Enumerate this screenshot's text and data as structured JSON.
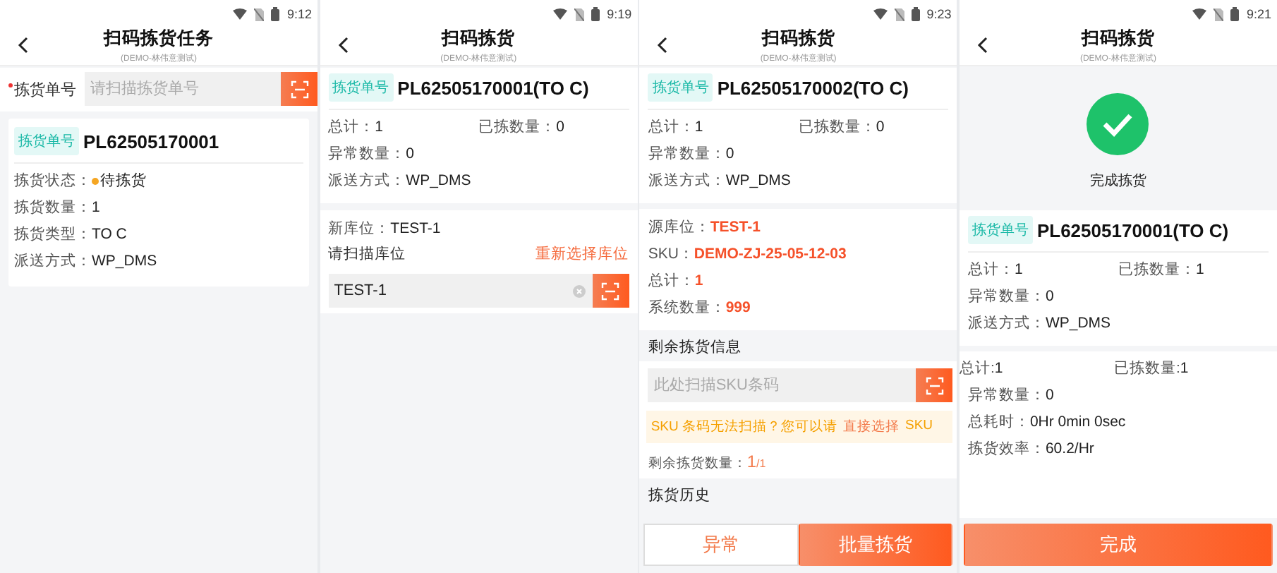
{
  "screens": [
    {
      "time": "9:12",
      "title": "扫码拣货任务",
      "subtitle": "(DEMO-林伟意测试)",
      "blocks": [
        {
          "kind": "scan_row",
          "label": "拣货单号",
          "required": true,
          "placeholder": "请扫描拣货单号"
        },
        {
          "kind": "order_card",
          "tag": "拣货单号",
          "number": "PL62505170001",
          "rows": [
            [
              {
                "label": "拣货状态：",
                "value": "待拣货",
                "color": "#f5a623"
              }
            ],
            [
              {
                "label": "拣货数量：",
                "value": "1"
              }
            ],
            [
              {
                "label": "拣货类型：",
                "value": "TO C"
              }
            ],
            [
              {
                "label": "派送方式：",
                "value": "WP_DMS"
              }
            ]
          ]
        }
      ]
    },
    {
      "time": "9:19",
      "title": "扫码拣货",
      "subtitle": "(DEMO-林伟意测试)",
      "blocks": [
        {
          "kind": "order_summary",
          "tag": "拣货单号",
          "number": "PL62505170001(TO C)",
          "rows": [
            [
              {
                "label": "总计：",
                "value": "1"
              },
              {
                "label": "已拣数量：",
                "value": "0"
              }
            ],
            [
              {
                "label": "异常数量：",
                "value": "0"
              }
            ],
            [
              {
                "label": "派送方式：",
                "value": "WP_DMS"
              }
            ]
          ]
        },
        {
          "kind": "location",
          "rows": [
            [
              {
                "label": "新库位：",
                "value": "TEST-1"
              }
            ]
          ],
          "prompt": "请扫描库位",
          "link": "重新选择库位",
          "value": "TEST-1"
        }
      ]
    },
    {
      "time": "9:23",
      "title": "扫码拣货",
      "subtitle": "(DEMO-林伟意测试)",
      "blocks": [
        {
          "kind": "order_summary",
          "tag": "拣货单号",
          "number": "PL62505170002(TO C)",
          "rows": [
            [
              {
                "label": "总计：",
                "value": "1"
              },
              {
                "label": "已拣数量：",
                "value": "0"
              }
            ],
            [
              {
                "label": "异常数量：",
                "value": "0"
              }
            ],
            [
              {
                "label": "派送方式：",
                "value": "WP_DMS"
              }
            ]
          ]
        },
        {
          "kind": "detail",
          "rows": [
            [
              {
                "label": "源库位：",
                "value": "TEST-1",
                "emphasis": true
              }
            ],
            [
              {
                "label": "SKU：",
                "value": "DEMO-ZJ-25-05-12-03",
                "emphasis": true
              }
            ],
            [
              {
                "label": "总计：",
                "value": "1",
                "emphasis": true
              }
            ],
            [
              {
                "label": "系统数量：",
                "value": "999",
                "emphasis": true
              }
            ]
          ]
        },
        {
          "kind": "section_title",
          "text": "剩余拣货信息"
        },
        {
          "kind": "sku_scan",
          "placeholder": "此处扫描SKU条码"
        },
        {
          "kind": "hint",
          "text": "SKU 条码无法扫描？您可以请",
          "link": "直接选择",
          "tail": "SKU"
        },
        {
          "kind": "remaining",
          "label": "剩余拣货数量：",
          "value": "1",
          "total": "/1"
        },
        {
          "kind": "section_title",
          "text": "拣货历史"
        },
        {
          "kind": "actions",
          "buttons": [
            {
              "label": "异常",
              "primary": false
            },
            {
              "label": "批量拣货",
              "primary": true
            }
          ]
        }
      ]
    },
    {
      "time": "9:21",
      "title": "扫码拣货",
      "subtitle": "(DEMO-林伟意测试)",
      "blocks": [
        {
          "kind": "success",
          "text": "完成拣货"
        },
        {
          "kind": "order_summary",
          "tag": "拣货单号",
          "number": "PL62505170001(TO C)",
          "rows": [
            [
              {
                "label": "总计：",
                "value": "1"
              },
              {
                "label": "已拣数量：",
                "value": "1"
              }
            ],
            [
              {
                "label": "异常数量：",
                "value": "0"
              }
            ],
            [
              {
                "label": "派送方式：",
                "value": "WP_DMS"
              }
            ]
          ]
        },
        {
          "kind": "stats",
          "rows": [
            [
              {
                "label": "总计:",
                "value": "1"
              },
              {
                "label": "已拣数量:",
                "value": "1"
              }
            ],
            [
              {
                "label": "异常数量：",
                "value": "0"
              }
            ],
            [
              {
                "label": "总耗时：",
                "value": "0Hr 0min 0sec"
              }
            ],
            [
              {
                "label": "拣货效率：",
                "value": "60.2/Hr"
              }
            ]
          ]
        },
        {
          "kind": "actions",
          "buttons": [
            {
              "label": "完成",
              "primary": true
            }
          ]
        }
      ]
    }
  ]
}
